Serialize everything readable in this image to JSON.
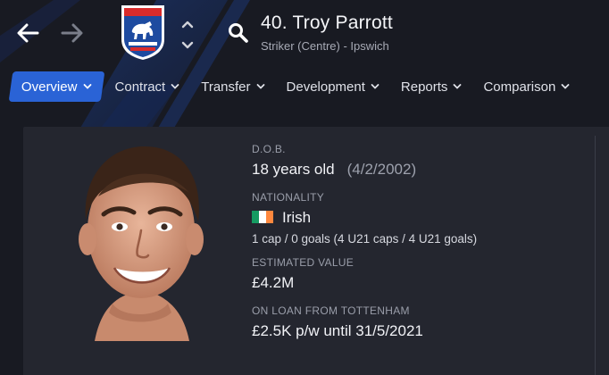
{
  "header": {
    "player_name": "40. Troy Parrott",
    "player_role": "Striker (Centre) - Ipswich",
    "crest_text": "IPSWICH TOWN FOOTBALL CLUB"
  },
  "tabs": [
    {
      "label": "Overview",
      "active": true
    },
    {
      "label": "Contract",
      "active": false
    },
    {
      "label": "Transfer",
      "active": false
    },
    {
      "label": "Development",
      "active": false
    },
    {
      "label": "Reports",
      "active": false
    },
    {
      "label": "Comparison",
      "active": false
    }
  ],
  "profile": {
    "dob_label": "D.O.B.",
    "age": "18 years old",
    "dob": "(4/2/2002)",
    "nationality_label": "NATIONALITY",
    "nationality": "Irish",
    "flag_colors": [
      "#169b62",
      "#ffffff",
      "#ff883e"
    ],
    "caps": "1 cap / 0 goals (4 U21 caps / 4 U21 goals)",
    "value_label": "ESTIMATED VALUE",
    "value": "£4.2M",
    "loan_label": "ON LOAN FROM TOTTENHAM",
    "loan": "£2.5K p/w until 31/5/2021"
  },
  "colors": {
    "accent": "#2a63d6",
    "background": "#181a22",
    "card": "#24262f",
    "stripe": "#1d3f8f"
  },
  "icons": {
    "back": "arrow-left-icon",
    "forward": "arrow-right-icon",
    "search": "search-icon",
    "updown": "chevron-updown-icon"
  }
}
